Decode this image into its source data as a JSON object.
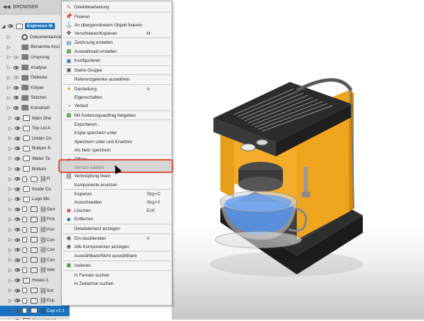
{
  "browser": {
    "title": "BROWSER",
    "root_label": "Espresso M",
    "rows": [
      {
        "label": "Dokumenteinste",
        "icon": "gear",
        "eye": "none"
      },
      {
        "label": "Benannte Ansi",
        "icon": "folder",
        "eye": "none"
      },
      {
        "label": "Ursprung",
        "icon": "folder",
        "eye": "off"
      },
      {
        "label": "Analyse",
        "icon": "folder",
        "eye": "on"
      },
      {
        "label": "Gelenke",
        "icon": "folder",
        "eye": "off"
      },
      {
        "label": "Körper",
        "icon": "folder",
        "eye": "on"
      },
      {
        "label": "Skizzen",
        "icon": "folder",
        "eye": "on"
      },
      {
        "label": "Konstrukt",
        "icon": "folder",
        "eye": "on"
      },
      {
        "label": "Main She",
        "icon": "sketch",
        "eye": "on"
      },
      {
        "label": "Top Lid A",
        "icon": "comp",
        "eye": "on"
      },
      {
        "label": "Under Co",
        "icon": "comp",
        "eye": "on"
      },
      {
        "label": "Bottom S",
        "icon": "comp",
        "eye": "on"
      },
      {
        "label": "Water Ta",
        "icon": "comp",
        "eye": "on"
      },
      {
        "label": "Bottom",
        "icon": "comp",
        "eye": "on"
      },
      {
        "label": "Fi",
        "icon": "comp",
        "eye": "on",
        "link": true
      },
      {
        "label": "Inside Co",
        "icon": "comp",
        "eye": "on"
      },
      {
        "label": "Logo Mo",
        "icon": "comp",
        "eye": "on"
      },
      {
        "label": "Gen",
        "icon": "body",
        "eye": "on",
        "link": true
      },
      {
        "label": "Frot",
        "icon": "body",
        "eye": "on",
        "link": true
      },
      {
        "label": "Pun",
        "icon": "body",
        "eye": "on",
        "link": true
      },
      {
        "label": "Con",
        "icon": "body",
        "eye": "on",
        "link": true
      },
      {
        "label": "Con",
        "icon": "body",
        "eye": "on",
        "link": true
      },
      {
        "label": "Con",
        "icon": "body",
        "eye": "on",
        "link": true
      },
      {
        "label": "Valv",
        "icon": "body",
        "eye": "on",
        "link": true
      },
      {
        "label": "Hoses:1",
        "icon": "body",
        "eye": "on"
      },
      {
        "label": "Sut",
        "icon": "body",
        "eye": "on",
        "link": true
      },
      {
        "label": "Esp",
        "icon": "body",
        "eye": "on",
        "link": true
      },
      {
        "label": "Cup v1:1",
        "icon": "body",
        "eye": "on",
        "link": true,
        "selected": true
      },
      {
        "label": "Connector:1",
        "icon": "body",
        "eye": "on"
      }
    ]
  },
  "menu": {
    "items": [
      {
        "label": "Direktbearbeitung",
        "icon": "pencil-icon",
        "glyph": "✎",
        "color": "#d9532c",
        "shortcut": ""
      },
      {
        "sep": true
      },
      {
        "label": "Fixieren",
        "icon": "pin-icon",
        "glyph": "📌",
        "color": "#c0392b",
        "shortcut": ""
      },
      {
        "label": "An übergeordnetem Objekt fixieren",
        "icon": "anchor-icon",
        "glyph": "⚓",
        "color": "#2f6fb3",
        "shortcut": ""
      },
      {
        "label": "Verschieben/Kopieren",
        "icon": "move-icon",
        "glyph": "✥",
        "color": "#333333",
        "shortcut": "M"
      },
      {
        "sep": true
      },
      {
        "label": "Zeichnung erstellen",
        "icon": "drawing-icon",
        "glyph": "▤",
        "color": "#3b76b8",
        "shortcut": ""
      },
      {
        "label": "Auswahlsatz erstellen",
        "icon": "selection-set-icon",
        "glyph": "▦",
        "color": "#3b8e3b",
        "shortcut": ""
      },
      {
        "sep": true
      },
      {
        "label": "Konfigurieren",
        "icon": "configure-icon",
        "glyph": "▣",
        "color": "#2f6fb3",
        "shortcut": ""
      },
      {
        "sep": true
      },
      {
        "label": "Starre Gruppe",
        "icon": "rigid-group-icon",
        "glyph": "▣",
        "color": "#5a5a5a",
        "shortcut": ""
      },
      {
        "sep": true
      },
      {
        "label": "Referenzgelenke auswählen",
        "icon": "",
        "glyph": "",
        "color": "#333333",
        "shortcut": ""
      },
      {
        "sep": true
      },
      {
        "label": "Darstellung",
        "icon": "appearance-icon",
        "glyph": "●",
        "color": "#e2a128",
        "shortcut": "A"
      },
      {
        "label": "Eigenschaften",
        "icon": "",
        "glyph": "",
        "color": "#333333",
        "shortcut": ""
      },
      {
        "label": "Verlauf",
        "icon": "history-icon",
        "glyph": "◔",
        "color": "#555555",
        "shortcut": ""
      },
      {
        "sep": true
      },
      {
        "label": "Mit Änderungsauftrag freigeben",
        "icon": "release-icon",
        "glyph": "▦",
        "color": "#3b8e3b",
        "shortcut": ""
      },
      {
        "sep": true
      },
      {
        "label": "Exportieren...",
        "icon": "",
        "glyph": "",
        "color": "#333333",
        "shortcut": ""
      },
      {
        "label": "Kopie speichern unter",
        "icon": "",
        "glyph": "",
        "color": "#333333",
        "shortcut": ""
      },
      {
        "label": "Speichern unter und Ersetzen",
        "icon": "",
        "glyph": "",
        "color": "#333333",
        "shortcut": ""
      },
      {
        "label": "Als Netz speichern",
        "icon": "",
        "glyph": "",
        "color": "#333333",
        "shortcut": ""
      },
      {
        "sep": true
      },
      {
        "label": "Öffnen",
        "icon": "open-folder-icon",
        "glyph": "▰",
        "color": "#555555",
        "shortcut": ""
      },
      {
        "label": "Version wählen",
        "icon": "",
        "glyph": "",
        "color": "#333333",
        "shortcut": ""
      },
      {
        "label": "Verknüpfung lösen",
        "icon": "unlink-icon",
        "glyph": "⛓",
        "color": "#333333",
        "shortcut": ""
      },
      {
        "label": "Komponente ersetzen",
        "icon": "",
        "glyph": "",
        "color": "#333333",
        "shortcut": ""
      },
      {
        "sep": true
      },
      {
        "label": "Kopieren",
        "icon": "",
        "glyph": "",
        "color": "#333333",
        "shortcut": "Strg+C"
      },
      {
        "label": "Ausschneiden",
        "icon": "",
        "glyph": "",
        "color": "#333333",
        "shortcut": "Strg+X"
      },
      {
        "label": "Löschen",
        "icon": "delete-icon",
        "glyph": "✖",
        "color": "#cc2222",
        "shortcut": "Entf"
      },
      {
        "label": "Entfernen",
        "icon": "remove-icon",
        "glyph": "◆",
        "color": "#2f6fb3",
        "shortcut": ""
      },
      {
        "sep": true
      },
      {
        "label": "Detailelement anzeigen",
        "icon": "",
        "glyph": "",
        "color": "#333333",
        "shortcut": ""
      },
      {
        "sep": true
      },
      {
        "label": "Ein-/ausblenden",
        "icon": "eye-icon",
        "glyph": "◉",
        "color": "#555555",
        "shortcut": "V"
      },
      {
        "label": "Alle Komponenten anzeigen",
        "icon": "show-all-icon",
        "glyph": "◉",
        "color": "#555555",
        "shortcut": ""
      },
      {
        "sep": true
      },
      {
        "label": "Auswählbare/Nicht auswählbare",
        "icon": "",
        "glyph": "",
        "color": "#333333",
        "shortcut": ""
      },
      {
        "sep": true
      },
      {
        "label": "Isolieren",
        "icon": "isolate-icon",
        "glyph": "▣",
        "color": "#3b8e3b",
        "shortcut": ""
      },
      {
        "sep": true
      },
      {
        "label": "In Fenster suchen",
        "icon": "",
        "glyph": "",
        "color": "#333333",
        "shortcut": ""
      },
      {
        "label": "In Zeitachse suchen",
        "icon": "",
        "glyph": "",
        "color": "#333333",
        "shortcut": ""
      }
    ],
    "highlighted": "Öffnen"
  },
  "colors": {
    "machine_body": "#f0a51e",
    "machine_metal": "#3a3a3a",
    "cup_liquid": "#4f8ee8",
    "selection_blue": "#1a73c0",
    "highlight_border": "#d64f3a"
  }
}
